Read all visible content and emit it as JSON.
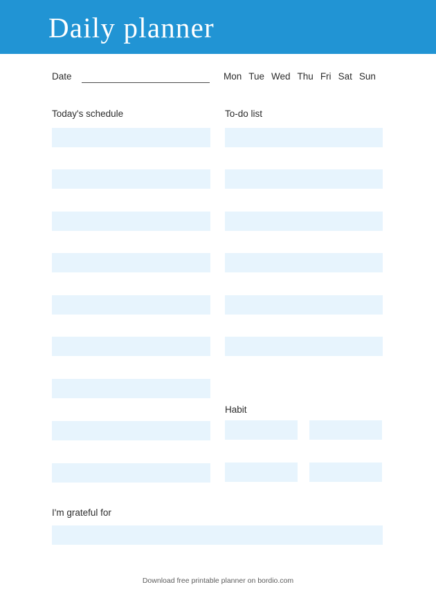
{
  "header": {
    "title": "Daily planner",
    "banner_color": "#2194d4",
    "title_color": "#ffffff"
  },
  "date_row": {
    "label": "Date",
    "value": "",
    "weekdays": [
      "Mon",
      "Tue",
      "Wed",
      "Thu",
      "Fri",
      "Sat",
      "Sun"
    ]
  },
  "schedule": {
    "label": "Today's schedule",
    "entries": [
      "",
      "",
      "",
      "",
      "",
      "",
      "",
      "",
      ""
    ]
  },
  "todo": {
    "label": "To-do list",
    "entries": [
      "",
      "",
      "",
      "",
      "",
      ""
    ]
  },
  "habit": {
    "label": "Habit",
    "rows": [
      {
        "filled": true,
        "cells": [
          "",
          ""
        ]
      },
      {
        "filled": false,
        "cells": [
          "",
          ""
        ]
      },
      {
        "filled": true,
        "cells": [
          "",
          ""
        ]
      },
      {
        "filled": false,
        "cells": [
          "",
          ""
        ]
      }
    ]
  },
  "grateful": {
    "label": "I'm grateful for",
    "value": ""
  },
  "footer": {
    "text": "Download free printable planner on bordio.com"
  },
  "colors": {
    "accent": "#2194d4",
    "field_fill": "#e7f4fd",
    "circle_stroke": "#6b8fc6",
    "text": "#2b2b2b",
    "footer_text": "#5c5c5c"
  }
}
